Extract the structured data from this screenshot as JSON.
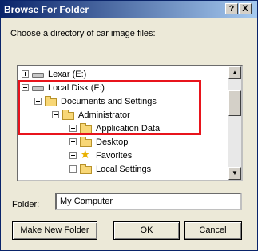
{
  "window": {
    "title": "Browse For Folder"
  },
  "titlebar": {
    "help_label": "?",
    "close_label": "X"
  },
  "description": "Choose a directory of car image files:",
  "tree": {
    "items": [
      {
        "label": "Lexar (E:)",
        "expander": "plus",
        "icon": "drive-icon"
      },
      {
        "label": "Local Disk (F:)",
        "expander": "minus",
        "icon": "drive-icon"
      },
      {
        "label": "Documents and Settings",
        "expander": "minus",
        "icon": "folder-icon"
      },
      {
        "label": "Administrator",
        "expander": "minus",
        "icon": "folder-icon"
      },
      {
        "label": "Application Data",
        "expander": "plus",
        "icon": "folder-icon"
      },
      {
        "label": "Desktop",
        "expander": "plus",
        "icon": "folder-icon"
      },
      {
        "label": "Favorites",
        "expander": "plus",
        "icon": "star-icon"
      },
      {
        "label": "Local Settings",
        "expander": "plus",
        "icon": "folder-icon"
      }
    ]
  },
  "folder": {
    "label": "Folder:",
    "value": "My Computer"
  },
  "buttons": {
    "make_new_folder": "Make New Folder",
    "ok": "OK",
    "cancel": "Cancel"
  },
  "colors": {
    "highlight": "#e8141c",
    "titlebar_start": "#0a246a",
    "titlebar_end": "#a6caf0"
  }
}
